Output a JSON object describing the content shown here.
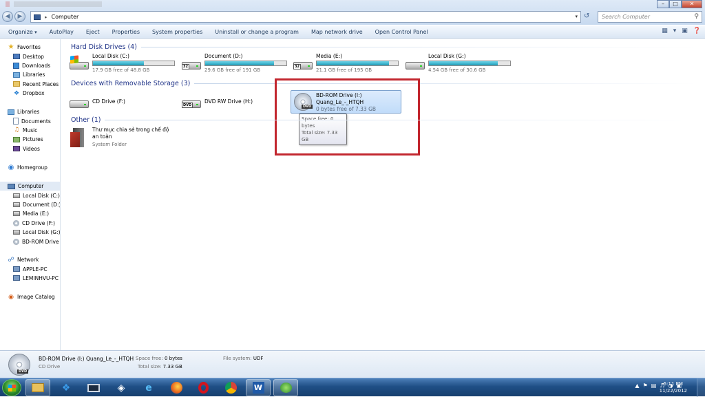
{
  "window": {
    "address": "Computer",
    "search_placeholder": "Search Computer"
  },
  "toolbar": {
    "items": [
      "Organize",
      "AutoPlay",
      "Eject",
      "Properties",
      "System properties",
      "Uninstall or change a program",
      "Map network drive",
      "Open Control Panel"
    ]
  },
  "sidebar": {
    "favorites": {
      "label": "Favorites",
      "items": [
        "Desktop",
        "Downloads",
        "Libraries",
        "Recent Places",
        "Dropbox"
      ]
    },
    "libraries": {
      "label": "Libraries",
      "items": [
        "Documents",
        "Music",
        "Pictures",
        "Videos"
      ]
    },
    "homegroup": {
      "label": "Homegroup"
    },
    "computer": {
      "label": "Computer",
      "items": [
        "Local Disk (C:)",
        "Document (D:)",
        "Media (E:)",
        "CD Drive (F:)",
        "Local Disk (G:)",
        "BD-ROM Drive ("
      ]
    },
    "network": {
      "label": "Network",
      "items": [
        "APPLE-PC",
        "LEMINHVU-PC"
      ]
    },
    "image_catalog": {
      "label": "Image Catalog"
    }
  },
  "hard_disks": {
    "title": "Hard Disk Drives (4)",
    "drives": [
      {
        "name": "Local Disk (C:)",
        "free": "17.9 GB free of 48.8 GB",
        "used_fraction": 0.63,
        "icon": "windows-drive-icon"
      },
      {
        "name": "Document (D:)",
        "free": "29.6 GB free of 191 GB",
        "used_fraction": 0.85,
        "icon": "hard-drive-icon"
      },
      {
        "name": "Media (E:)",
        "free": "21.1 GB free of 195 GB",
        "used_fraction": 0.89,
        "icon": "hard-drive-icon"
      },
      {
        "name": "Local Disk (G:)",
        "free": "4.54 GB free of 30.6 GB",
        "used_fraction": 0.85,
        "icon": "hard-drive-icon"
      }
    ]
  },
  "removable": {
    "title": "Devices with Removable Storage (3)",
    "drives": [
      {
        "name": "CD Drive (F:)"
      },
      {
        "name": "DVD RW Drive (H:)"
      }
    ],
    "selected": {
      "name": "BD-ROM Drive (I:)",
      "label": "Quang_Le_-_HTQH",
      "free": "0 bytes free of 7.33 GB",
      "tooltip_free": "Space free: 0 bytes",
      "tooltip_total": "Total size: 7.33 GB"
    }
  },
  "other": {
    "title": "Other (1)",
    "item": {
      "name": "Thư mục chia sẻ trong chế độ an toàn",
      "type": "System Folder"
    }
  },
  "details": {
    "name": "BD-ROM Drive (I:) Quang_Le_-_HTQH",
    "type": "CD Drive",
    "space_free_label": "Space free:",
    "space_free": "0 bytes",
    "total_size_label": "Total size:",
    "total_size": "7.33 GB",
    "fs_label": "File system:",
    "fs": "UDF"
  },
  "taskbar": {
    "time": "5:11 PM",
    "date": "11/22/2012"
  },
  "colors": {
    "highlight": "#c2262e",
    "bar_fill": "#1f9cb8",
    "section_title": "#1e3287"
  }
}
